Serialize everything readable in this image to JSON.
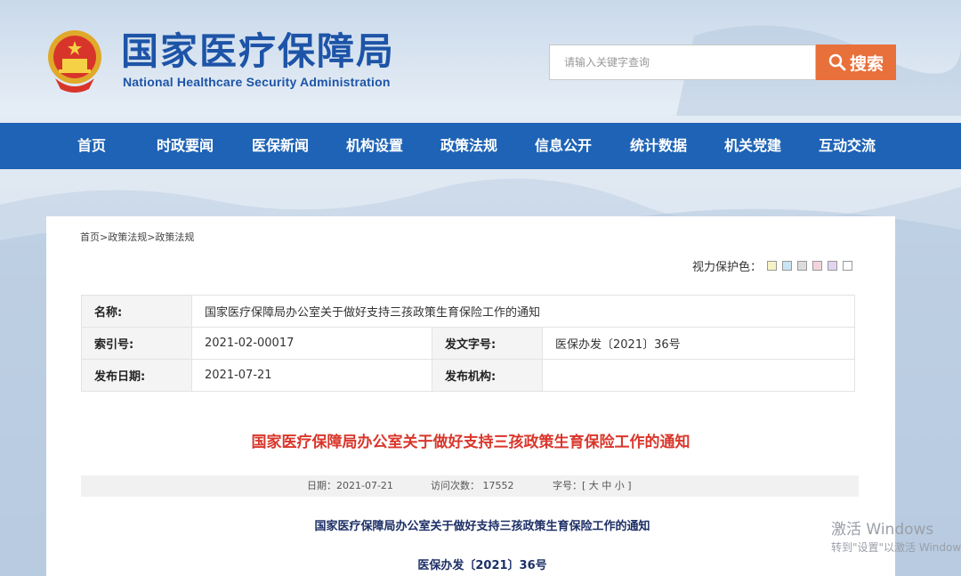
{
  "header": {
    "site_title": "国家医疗保障局",
    "site_subtitle": "National Healthcare Security Administration",
    "search_placeholder": "请输入关键字查询",
    "search_label": "搜索"
  },
  "nav": {
    "items": [
      "首页",
      "时政要闻",
      "医保新闻",
      "机构设置",
      "政策法规",
      "信息公开",
      "统计数据",
      "机关党建",
      "互动交流"
    ]
  },
  "breadcrumb": "首页>政策法规>政策法规",
  "eye_protect": {
    "label": "视力保护色：",
    "swatches": [
      "#f7f3c6",
      "#c9e4f2",
      "#dcdcdc",
      "#f3d4dd",
      "#e2d4f0",
      "#ffffff"
    ]
  },
  "meta": {
    "name_label": "名称:",
    "name_value": "国家医疗保障局办公室关于做好支持三孩政策生育保险工作的通知",
    "index_label": "索引号:",
    "index_value": "2021-02-00017",
    "docno_label": "发文字号:",
    "docno_value": "医保办发〔2021〕36号",
    "date_label": "发布日期:",
    "date_value": "2021-07-21",
    "org_label": "发布机构:",
    "org_value": ""
  },
  "article": {
    "title": "国家医疗保障局办公室关于做好支持三孩政策生育保险工作的通知",
    "date_text": "日期：2021-07-21",
    "visits_text": "访问次数： 17552",
    "fontsize_text": "字号：[ 大 中 小 ]",
    "body_title": "国家医疗保障局办公室关于做好支持三孩政策生育保险工作的通知",
    "doc_number": "医保办发〔2021〕36号"
  },
  "watermark": {
    "line1": "激活 Windows",
    "line2": "转到\"设置\"以激活 Windows。"
  },
  "colors": {
    "brand_blue": "#1e63b5",
    "search_orange": "#e8703a",
    "title_red": "#d9362b"
  }
}
